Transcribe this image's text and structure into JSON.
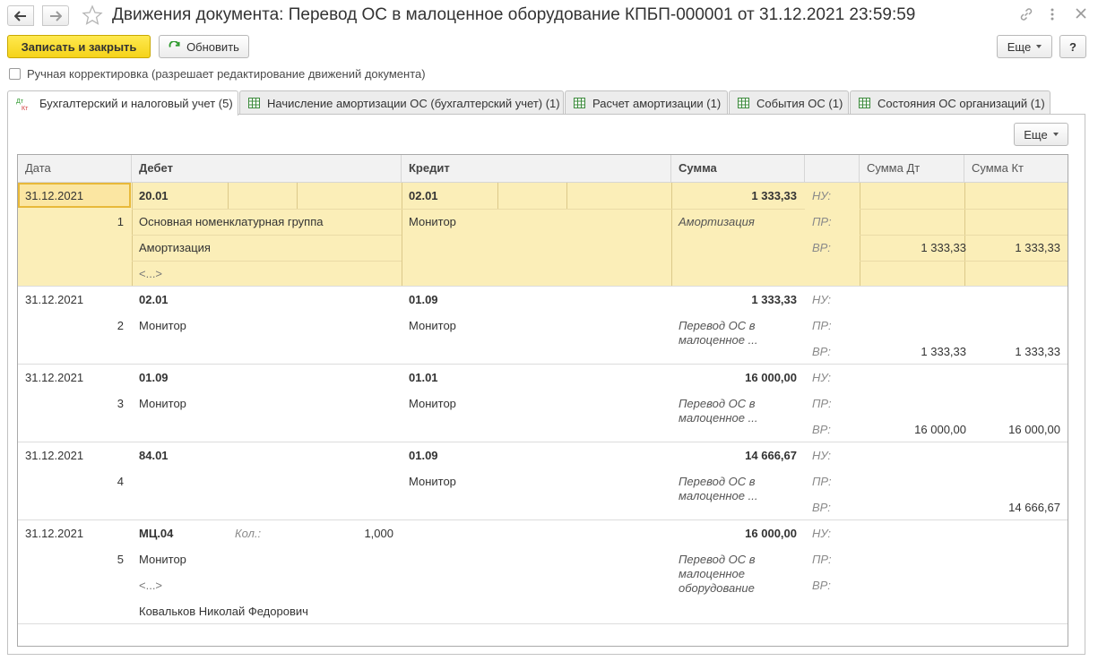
{
  "window": {
    "title": "Движения документа: Перевод ОС в малоценное оборудование КПБП-000001 от 31.12.2021 23:59:59"
  },
  "toolbar": {
    "save_close": "Записать и закрыть",
    "refresh": "Обновить",
    "more": "Еще",
    "help": "?"
  },
  "manual_edit": {
    "label": "Ручная корректировка (разрешает редактирование движений документа)",
    "checked": false
  },
  "tabs": [
    {
      "label": "Бухгалтерский и налоговый учет (5)",
      "active": true
    },
    {
      "label": "Начисление амортизации ОС (бухгалтерский учет) (1)"
    },
    {
      "label": "Расчет амортизации (1)"
    },
    {
      "label": "События ОС (1)"
    },
    {
      "label": "Состояния ОС организаций (1)"
    }
  ],
  "panel": {
    "more": "Еще"
  },
  "grid": {
    "headers": {
      "date": "Дата",
      "debit": "Дебет",
      "credit": "Кредит",
      "sum": "Сумма",
      "sum_dt": "Сумма Дт",
      "sum_kt": "Сумма Кт"
    },
    "labels": {
      "nu": "НУ:",
      "pr": "ПР:",
      "vr": "ВР:",
      "qty": "Кол.:"
    },
    "rows": [
      {
        "date": "31.12.2021",
        "num": "1",
        "debit_account": "20.01",
        "debit_sub1": "Основная номенклатурная группа",
        "debit_sub2": "Амортизация",
        "debit_sub3": "<...>",
        "credit_account": "02.01",
        "credit_sub1": "Монитор",
        "sum": "1 333,33",
        "content": "Амортизация",
        "vr_dt": "1 333,33",
        "vr_kt": "1 333,33"
      },
      {
        "date": "31.12.2021",
        "num": "2",
        "debit_account": "02.01",
        "debit_sub1": "Монитор",
        "credit_account": "01.09",
        "credit_sub1": "Монитор",
        "sum": "1 333,33",
        "content": "Перевод ОС в малоценное ...",
        "vr_dt": "1 333,33",
        "vr_kt": "1 333,33"
      },
      {
        "date": "31.12.2021",
        "num": "3",
        "debit_account": "01.09",
        "debit_sub1": "Монитор",
        "credit_account": "01.01",
        "credit_sub1": "Монитор",
        "sum": "16 000,00",
        "content": "Перевод ОС в малоценное ...",
        "vr_dt": "16 000,00",
        "vr_kt": "16 000,00"
      },
      {
        "date": "31.12.2021",
        "num": "4",
        "debit_account": "84.01",
        "credit_account": "01.09",
        "credit_sub1": "Монитор",
        "sum": "14 666,67",
        "content": "Перевод ОС в малоценное ...",
        "vr_kt": "14 666,67"
      },
      {
        "date": "31.12.2021",
        "num": "5",
        "debit_account": "МЦ.04",
        "debit_qty": "1,000",
        "debit_sub1": "Монитор",
        "debit_sub2": "<...>",
        "debit_sub3": "Ковальков Николай Федорович",
        "sum": "16 000,00",
        "content": "Перевод ОС в малоценное оборудование"
      }
    ]
  }
}
